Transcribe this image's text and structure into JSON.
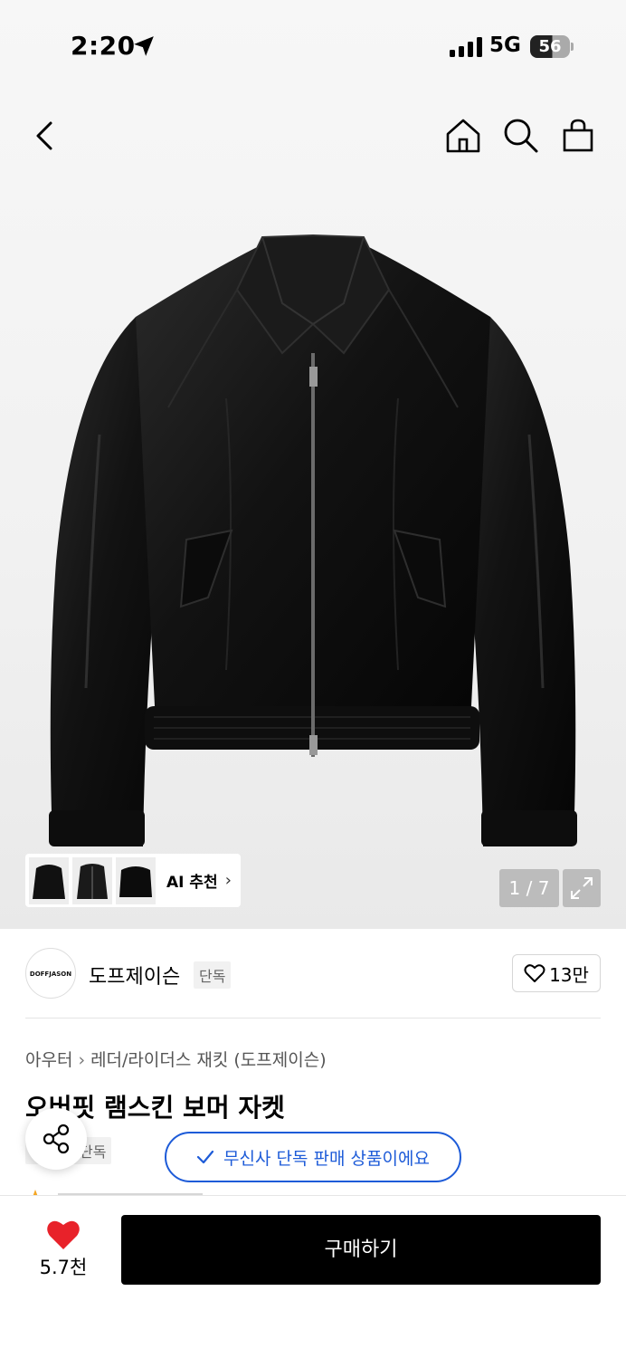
{
  "status_bar": {
    "time": "2:20",
    "network": "5G",
    "battery": "56"
  },
  "nav": {
    "back_icon": "chevron-left-icon",
    "home_icon": "home-icon",
    "search_icon": "search-icon",
    "cart_icon": "shopping-bag-icon"
  },
  "gallery": {
    "ai_label": "AI 추천",
    "counter": "1 / 7",
    "thumb_count": 3
  },
  "brand": {
    "logo_text": "DOFFJASON",
    "name": "도프제이슨",
    "tag": "단독",
    "likes": "13만"
  },
  "breadcrumb": {
    "category": "아우터",
    "subcategory": "레더/라이더스 재킷 (도프제이슨)"
  },
  "product": {
    "title": "오버핏 램스킨 보머 자켓",
    "tag": "단독",
    "exclusive_notice": "무신사 단독 판매 상품이에요"
  },
  "bottom": {
    "wishlist_count": "5.7천",
    "buy_label": "구매하기"
  },
  "colors": {
    "accent_blue": "#1d5bd8",
    "heart_red": "#e8222a"
  }
}
